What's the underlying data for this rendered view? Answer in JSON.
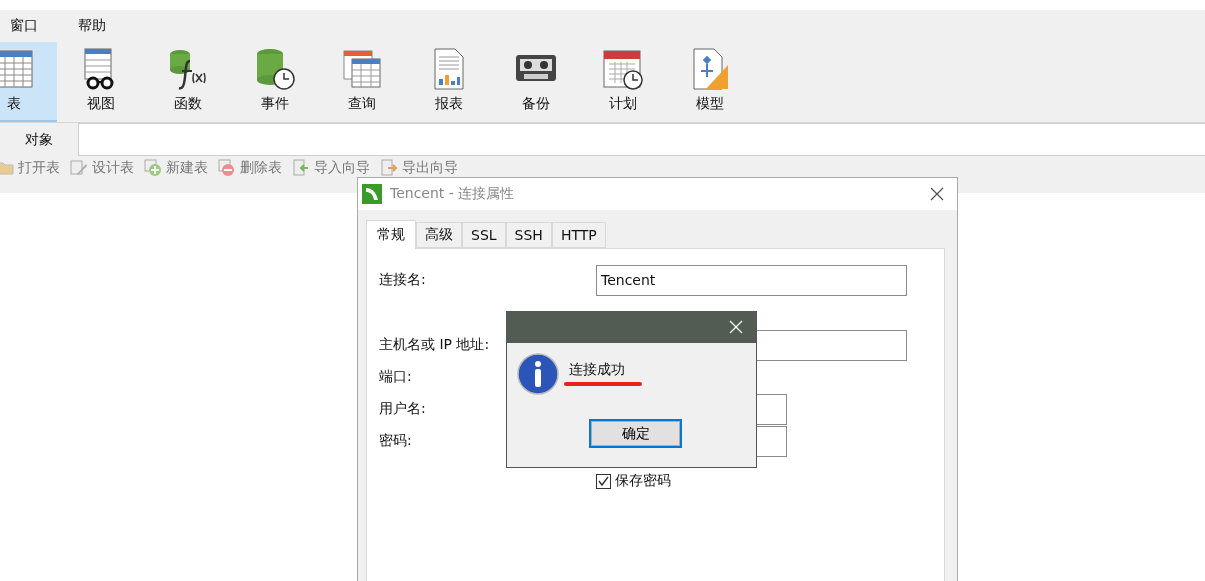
{
  "menu": [
    {
      "label": "窗口"
    },
    {
      "label": "帮助"
    }
  ],
  "ribbon": [
    {
      "label": "表",
      "kind": "table",
      "selected": true
    },
    {
      "label": "视图",
      "kind": "view",
      "selected": false
    },
    {
      "label": "函数",
      "kind": "function",
      "selected": false
    },
    {
      "label": "事件",
      "kind": "event",
      "selected": false
    },
    {
      "label": "查询",
      "kind": "query",
      "selected": false
    },
    {
      "label": "报表",
      "kind": "report",
      "selected": false
    },
    {
      "label": "备份",
      "kind": "backup",
      "selected": false
    },
    {
      "label": "计划",
      "kind": "schedule",
      "selected": false
    },
    {
      "label": "模型",
      "kind": "model",
      "selected": false
    }
  ],
  "object_tab": {
    "label": "对象",
    "selected": true
  },
  "toolbar": [
    {
      "label": "打开表",
      "kind": "open"
    },
    {
      "label": "设计表",
      "kind": "design"
    },
    {
      "label": "新建表",
      "kind": "new"
    },
    {
      "label": "删除表",
      "kind": "delete"
    },
    {
      "label": "导入向导",
      "kind": "import"
    },
    {
      "label": "导出向导",
      "kind": "export"
    }
  ],
  "dialog": {
    "title": "Tencent - 连接属性",
    "tabs": [
      {
        "label": "常规",
        "selected": true
      },
      {
        "label": "高级",
        "selected": false
      },
      {
        "label": "SSL",
        "selected": false
      },
      {
        "label": "SSH",
        "selected": false
      },
      {
        "label": "HTTP",
        "selected": false
      }
    ],
    "fields": [
      {
        "label": "连接名:",
        "kind": "wide",
        "value": "Tencent"
      },
      {
        "label": "主机名或 IP 地址:",
        "kind": "wide"
      },
      {
        "label": "端口:",
        "kind": "hidden"
      },
      {
        "label": "用户名:",
        "kind": "short"
      },
      {
        "label": "密码:",
        "kind": "short"
      }
    ],
    "save_password": {
      "label": "保存密码",
      "checked": true
    }
  },
  "message": {
    "text": "连接成功",
    "button": "确定"
  }
}
